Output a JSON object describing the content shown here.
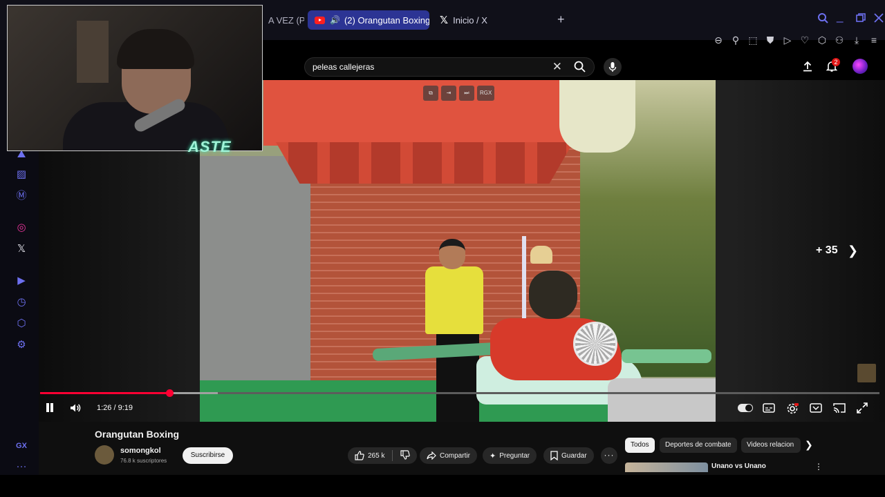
{
  "browser": {
    "tabs": [
      {
        "label": "A VEZ (P"
      },
      {
        "label": "(2) Orangutan Boxing",
        "active": true
      },
      {
        "label": "Inicio / X"
      }
    ],
    "new_tab_label": "+",
    "accent_color": "#6d70f0"
  },
  "youtube": {
    "search": {
      "value": "peleas callejeras"
    },
    "notification_count": "2"
  },
  "player": {
    "overlay_controls": [
      "⧉",
      "⇥",
      "⏭",
      "RGX"
    ],
    "skip_label": "+ 35",
    "time": "1:26 / 9:19",
    "progress_played_fraction": 0.154,
    "progress_loaded_fraction": 0.212
  },
  "stream": {
    "logo_text": "ASTE"
  },
  "video": {
    "title": "Orangutan Boxing",
    "channel": "somongkol",
    "subscribers": "76.8 k suscriptores",
    "subscribe_label": "Suscribirse",
    "likes": "265 k",
    "share_label": "Compartir",
    "ask_label": "Preguntar",
    "save_label": "Guardar"
  },
  "related": {
    "chips": [
      "Todos",
      "Deportes de combate",
      "Videos relacion"
    ],
    "first_title": "Unano vs Unano"
  },
  "sidebar_icons": [
    "images-icon",
    "stripes-icon",
    "m-icon",
    "instagram-icon",
    "x-icon",
    "player-icon",
    "history-icon",
    "extensions-icon",
    "settings-icon",
    "gx-icon",
    "more-icon"
  ]
}
